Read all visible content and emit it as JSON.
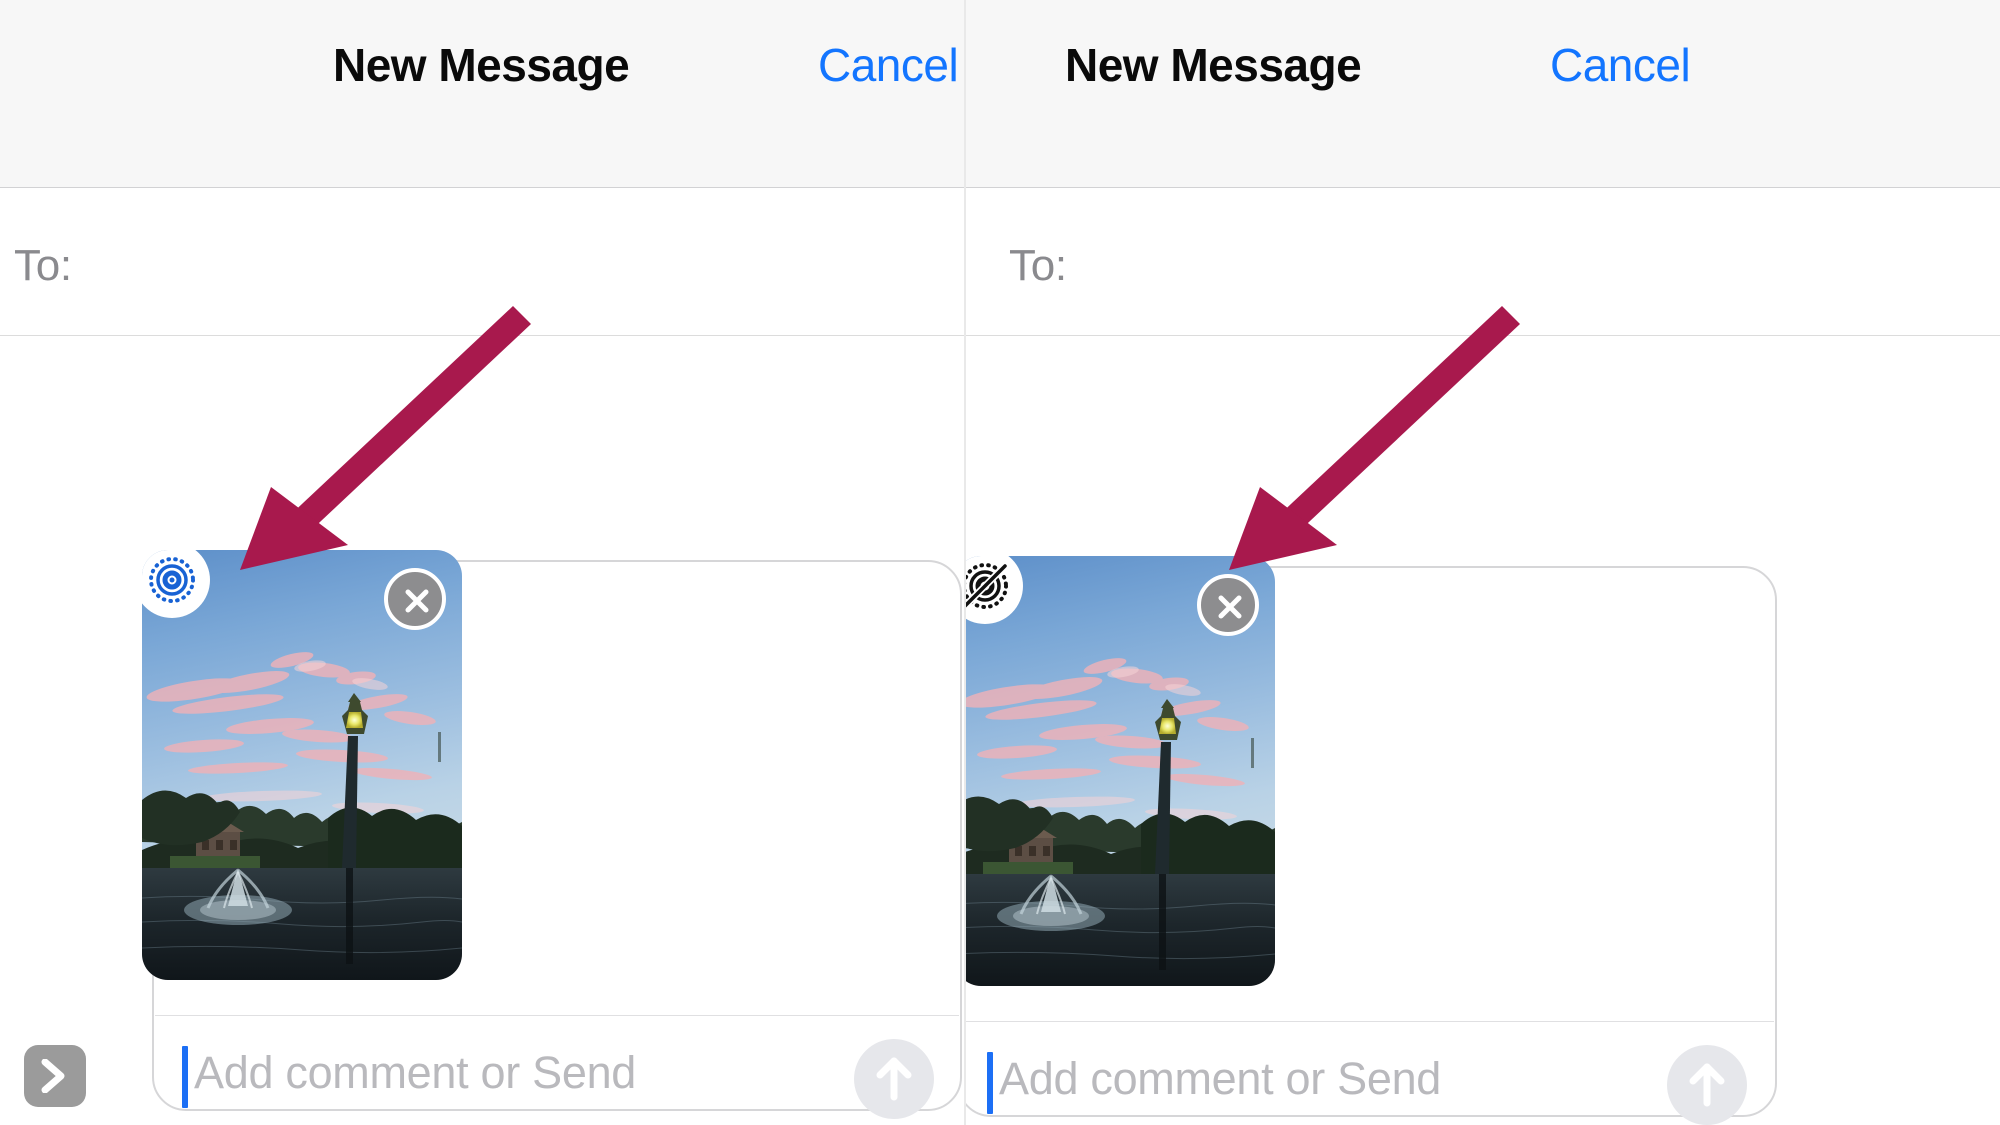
{
  "meta": {
    "app": "Messages",
    "screen": "New Message composer",
    "comparison": "Live Photo enabled (left) vs Live Photo disabled (right)",
    "accent_blue": "#1375ff",
    "annotation_color": "#a8194d",
    "nav_background": "#f7f7f7",
    "send_button_background": "#e6e7eb",
    "expand_button_background": "#9b9b9b"
  },
  "panels": [
    {
      "id": "left",
      "navbar": {
        "title": "New Message",
        "cancel_label": "Cancel"
      },
      "recipients": {
        "label": "To:",
        "value": ""
      },
      "composer": {
        "placeholder": "Add comment or Send",
        "value": "",
        "caret_visible": true,
        "send_icon": "arrow-up-icon",
        "expand_icon": "chevron-right-icon"
      },
      "attachment": {
        "type": "photo",
        "live_photo_enabled": true,
        "live_badge_icon": "live-photo-on-icon",
        "live_badge_color": "#1862d4",
        "remove_icon": "close-icon",
        "description": "Sunset over a pond with a lit lamp post, pink clouds, silhouetted trees and a fountain"
      }
    },
    {
      "id": "right",
      "navbar": {
        "title": "New Message",
        "cancel_label": "Cancel"
      },
      "recipients": {
        "label": "To:",
        "value": ""
      },
      "composer": {
        "placeholder": "Add comment or Send",
        "value": "",
        "caret_visible": true,
        "send_icon": "arrow-up-icon",
        "expand_icon": "chevron-right-icon"
      },
      "attachment": {
        "type": "photo",
        "live_photo_enabled": false,
        "live_badge_icon": "live-photo-off-icon",
        "live_badge_color": "#111111",
        "remove_icon": "close-icon",
        "description": "Sunset over a pond with a lit lamp post, pink clouds, silhouetted trees and a fountain"
      }
    }
  ],
  "annotations": [
    {
      "id": "arrow-left",
      "type": "arrow",
      "points_to": "live-photo-on-badge",
      "color": "#a8194d"
    },
    {
      "id": "arrow-right",
      "type": "arrow",
      "points_to": "live-photo-off-badge",
      "color": "#a8194d"
    }
  ]
}
